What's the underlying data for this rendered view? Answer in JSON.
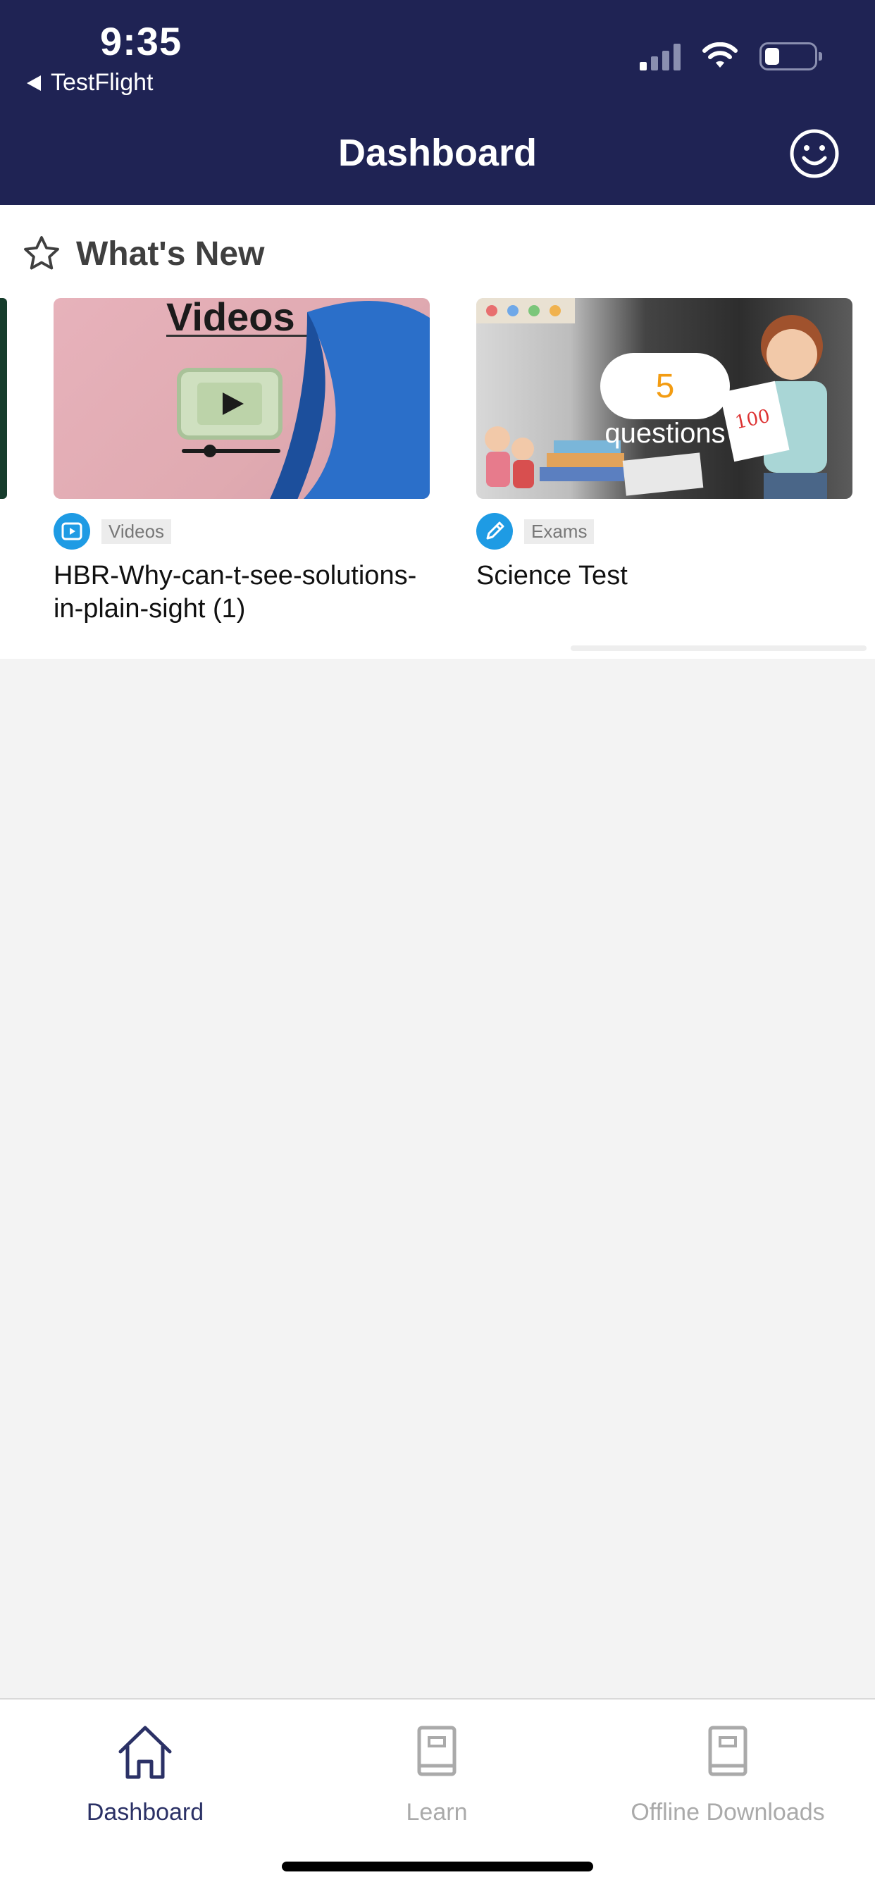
{
  "status_bar": {
    "time": "9:35",
    "back_label": "TestFlight"
  },
  "header": {
    "title": "Dashboard"
  },
  "whats_new": {
    "title": "What's New",
    "cards": [
      {
        "category": "Videos",
        "title": "HBR-Why-can-t-see-solutions-in-plain-sight (1)",
        "thumb_text": "Videos"
      },
      {
        "category": "Exams",
        "title": "Science Test",
        "question_count": "5",
        "question_label": "questions"
      }
    ]
  },
  "tabs": [
    {
      "label": "Dashboard",
      "active": true
    },
    {
      "label": "Learn",
      "active": false
    },
    {
      "label": "Offline Downloads",
      "active": false
    }
  ],
  "colors": {
    "header_bg": "#1f2354",
    "accent_blue": "#1e9be4",
    "question_orange": "#f39c12",
    "active_tab": "#2b3166"
  }
}
